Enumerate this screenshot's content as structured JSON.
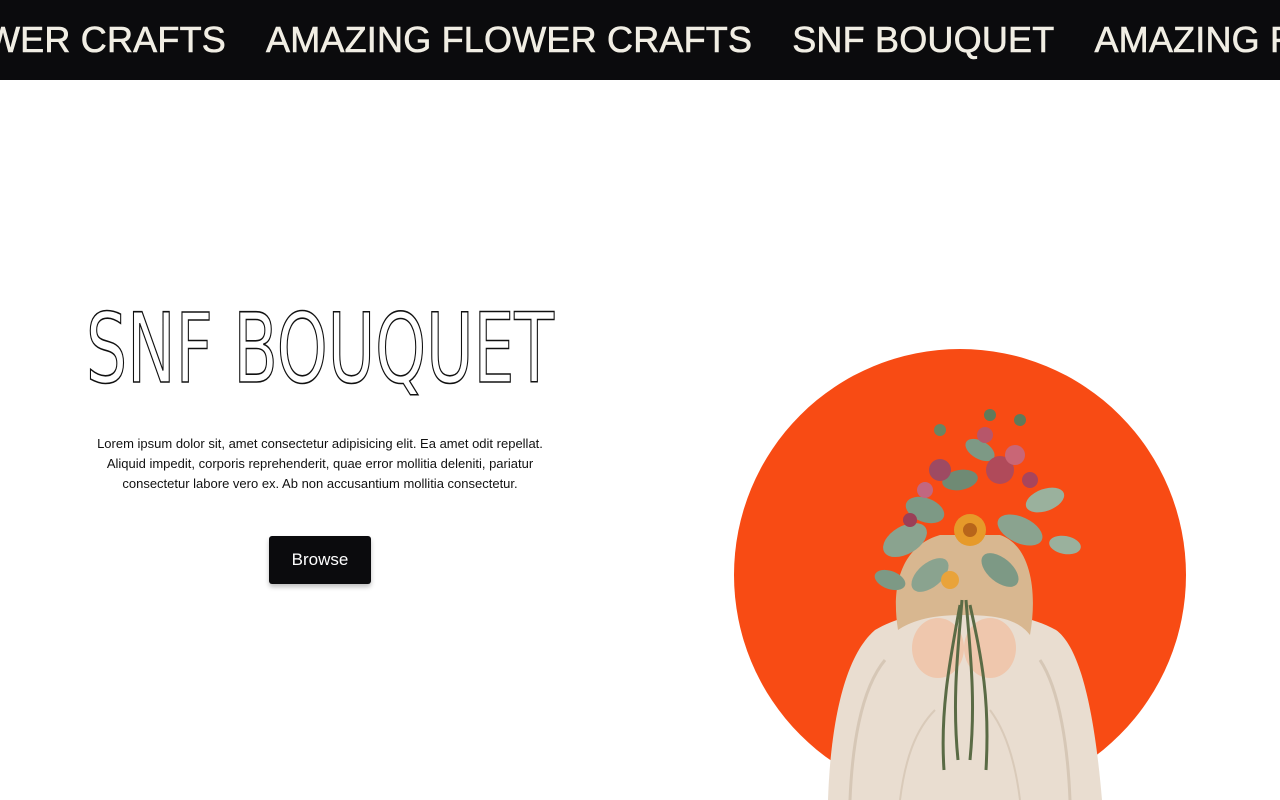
{
  "marquee": {
    "items": [
      "WER CRAFTS",
      "AMAZING FLOWER CRAFTS",
      "SNF BOUQUET",
      "AMAZING FLO"
    ]
  },
  "hero": {
    "title": "SNF BOUQUET",
    "description": "Lorem ipsum dolor sit, amet consectetur adipisicing elit. Ea amet odit repellat. Aliquid impedit, corporis reprehenderit, quae error mollitia deleniti, pariatur consectetur labore vero ex. Ab non accusantium mollitia consectetur.",
    "browse_label": "Browse"
  },
  "colors": {
    "marquee_bg": "#0b0b0d",
    "marquee_text": "#f1eee4",
    "accent_circle": "#f84b14",
    "button_bg": "#0b0b0d"
  },
  "icons": {
    "hero_image": "woman-holding-flower-bouquet-illustration"
  }
}
